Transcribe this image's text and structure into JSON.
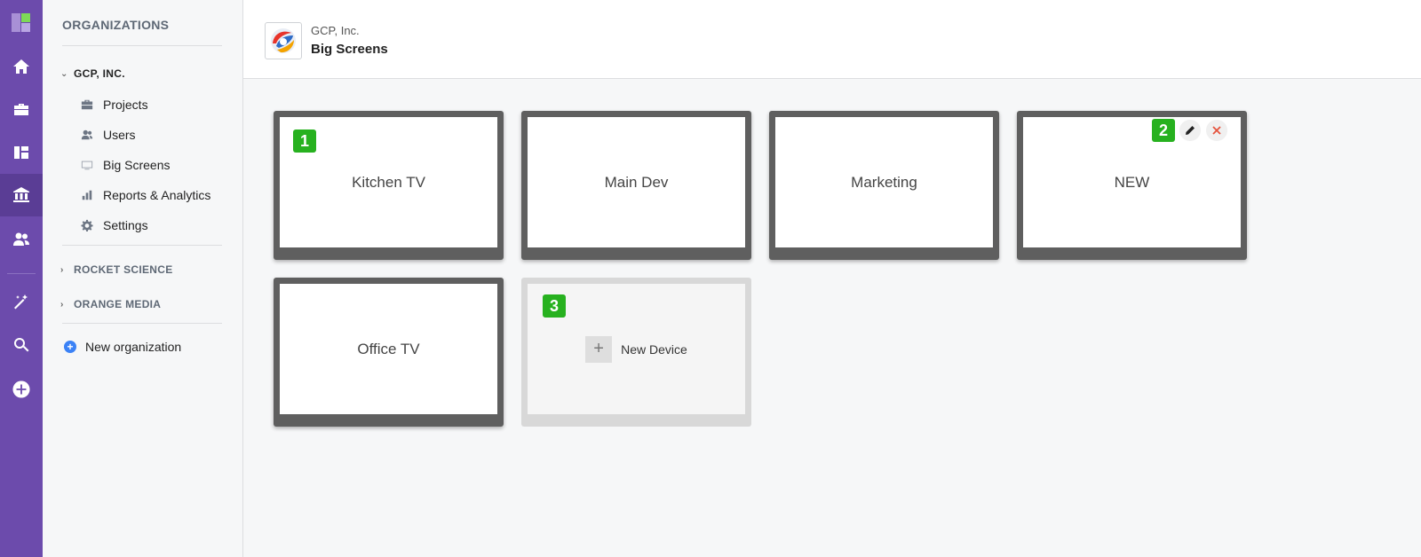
{
  "sidebar": {
    "title": "ORGANIZATIONS",
    "orgs": [
      {
        "name": "GCP, INC.",
        "expanded": true
      },
      {
        "name": "ROCKET SCIENCE",
        "expanded": false
      },
      {
        "name": "ORANGE MEDIA",
        "expanded": false
      }
    ],
    "items": [
      {
        "label": "Projects",
        "icon": "briefcase-icon"
      },
      {
        "label": "Users",
        "icon": "users-icon"
      },
      {
        "label": "Big Screens",
        "icon": "monitor-icon"
      },
      {
        "label": "Reports & Analytics",
        "icon": "bar-chart-icon"
      },
      {
        "label": "Settings",
        "icon": "gear-icon"
      }
    ],
    "new_org_label": "New organization"
  },
  "header": {
    "org_name": "GCP, Inc.",
    "title": "Big Screens"
  },
  "devices": [
    {
      "name": "Kitchen TV",
      "badge": "1"
    },
    {
      "name": "Main Dev"
    },
    {
      "name": "Marketing"
    },
    {
      "name": "NEW",
      "badge": "2"
    },
    {
      "name": "Office TV"
    }
  ],
  "new_device": {
    "label": "New Device",
    "badge": "3"
  },
  "colors": {
    "rail": "#6c4bac",
    "badge": "#27b11f",
    "delete": "#e5533d",
    "link_plus": "#3b82f6"
  }
}
